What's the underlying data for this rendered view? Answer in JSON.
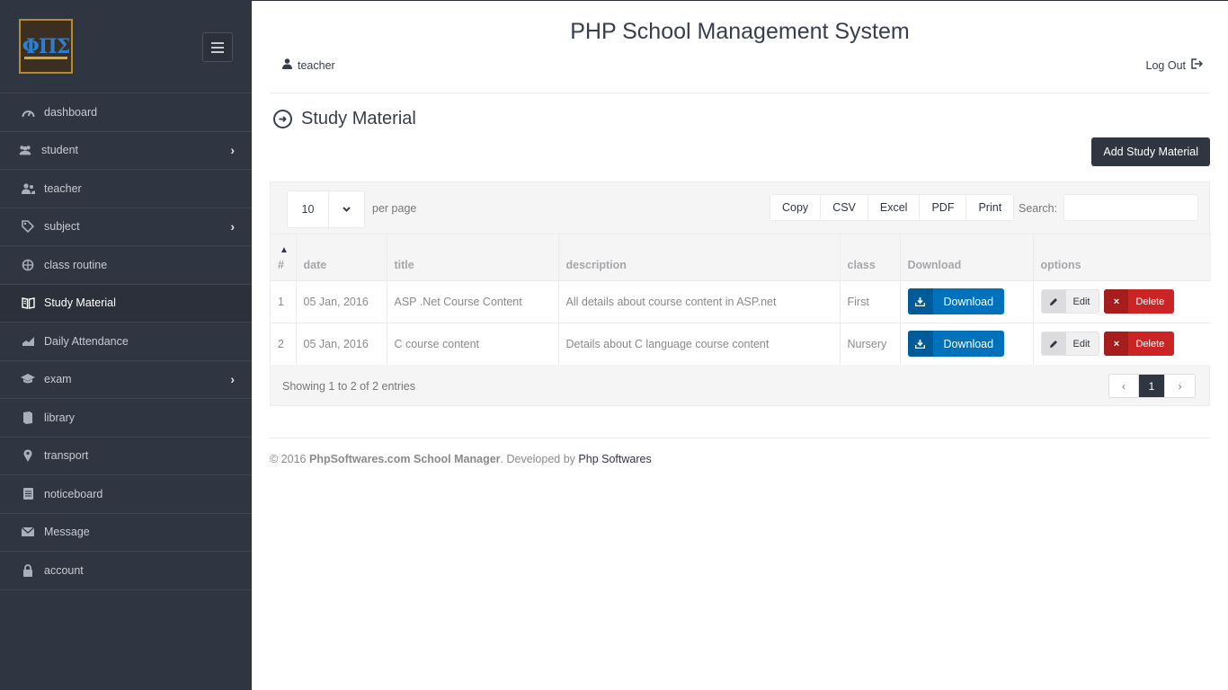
{
  "app": {
    "title": "PHP School Management System"
  },
  "logo": {
    "text": "ΦΠΣ"
  },
  "header": {
    "user": "teacher",
    "logout": "Log Out"
  },
  "sidebar": {
    "items": [
      {
        "label": "dashboard",
        "icon": "gauge-icon",
        "submenu": false
      },
      {
        "label": "student",
        "icon": "users-icon",
        "submenu": true
      },
      {
        "label": "teacher",
        "icon": "user-group-icon",
        "submenu": false
      },
      {
        "label": "subject",
        "icon": "tag-icon",
        "submenu": true
      },
      {
        "label": "class routine",
        "icon": "crosshair-icon",
        "submenu": false
      },
      {
        "label": "Study Material",
        "icon": "book-icon",
        "submenu": false,
        "active": true
      },
      {
        "label": "Daily Attendance",
        "icon": "chart-area-icon",
        "submenu": false
      },
      {
        "label": "exam",
        "icon": "graduation-cap-icon",
        "submenu": true
      },
      {
        "label": "library",
        "icon": "book-closed-icon",
        "submenu": false
      },
      {
        "label": "transport",
        "icon": "location-pin-icon",
        "submenu": false
      },
      {
        "label": "noticeboard",
        "icon": "document-icon",
        "submenu": false
      },
      {
        "label": "Message",
        "icon": "envelope-icon",
        "submenu": false
      },
      {
        "label": "account",
        "icon": "lock-icon",
        "submenu": false
      }
    ]
  },
  "page": {
    "title": "Study Material",
    "add_button": "Add Study Material"
  },
  "table_controls": {
    "page_length": "10",
    "per_page_label": "per page",
    "tools": [
      "Copy",
      "CSV",
      "Excel",
      "PDF",
      "Print"
    ],
    "search_label": "Search:"
  },
  "table": {
    "columns": [
      "#",
      "date",
      "title",
      "description",
      "class",
      "Download",
      "options"
    ],
    "rows": [
      {
        "num": "1",
        "date": "05 Jan, 2016",
        "title": "ASP .Net Course Content",
        "description": "All details about course content in ASP.net",
        "class": "First"
      },
      {
        "num": "2",
        "date": "05 Jan, 2016",
        "title": "C course content",
        "description": "Details about C language course content",
        "class": "Nursery"
      }
    ],
    "download_label": "Download",
    "edit_label": "Edit",
    "delete_label": "Delete",
    "info": "Showing 1 to 2 of 2 entries",
    "pager": {
      "prev": "‹",
      "current": "1",
      "next": "›"
    }
  },
  "footer": {
    "prefix": "© 2016",
    "brand": "PhpSoftwares.com School Manager",
    "middle": ". Developed by",
    "developer": "Php Softwares"
  },
  "colors": {
    "sidebar_bg": "#303641",
    "primary": "#0072bc",
    "danger": "#cc2424"
  }
}
